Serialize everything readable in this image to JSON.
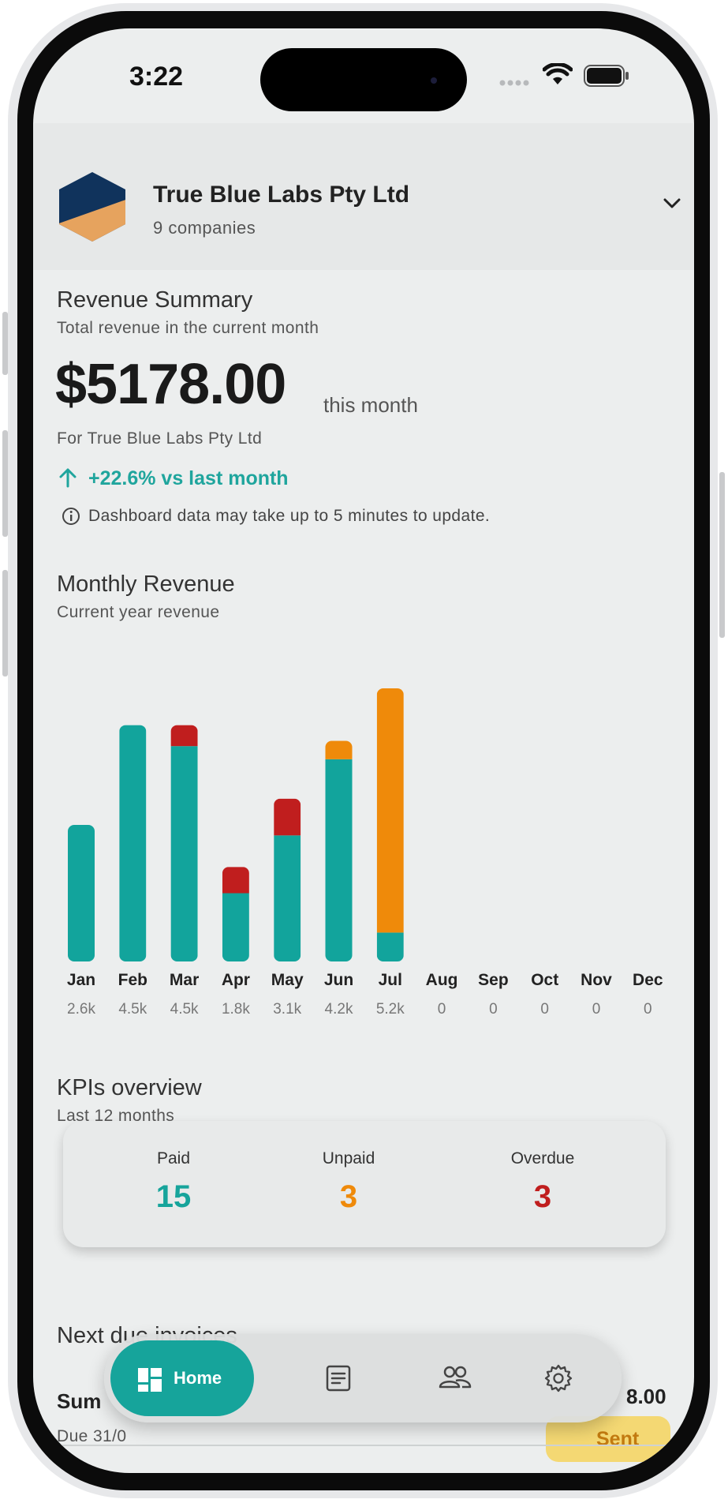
{
  "status_bar": {
    "time": "3:22"
  },
  "header": {
    "company_name": "True Blue Labs Pty Ltd",
    "company_count": "9 companies"
  },
  "revenue_summary": {
    "title": "Revenue Summary",
    "subtitle": "Total revenue in the current month",
    "amount": "$5178.00",
    "period": "this month",
    "for_company": "For True Blue Labs Pty Ltd",
    "trend": "+22.6% vs last month",
    "notice": "Dashboard data may take up to 5 minutes to update."
  },
  "monthly_revenue": {
    "title": "Monthly Revenue",
    "subtitle": "Current year revenue"
  },
  "chart_data": {
    "type": "bar",
    "categories": [
      "Jan",
      "Feb",
      "Mar",
      "Apr",
      "May",
      "Jun",
      "Jul",
      "Aug",
      "Sep",
      "Oct",
      "Nov",
      "Dec"
    ],
    "value_labels": [
      "2.6k",
      "4.5k",
      "4.5k",
      "1.8k",
      "3.1k",
      "4.2k",
      "5.2k",
      "0",
      "0",
      "0",
      "0",
      "0"
    ],
    "series": [
      {
        "values": [
          2.6,
          4.5,
          4.1,
          1.3,
          2.4,
          3.85,
          0.55,
          0,
          0,
          0,
          0,
          0
        ]
      },
      {
        "values": [
          0,
          0,
          0.4,
          0.5,
          0.7,
          0,
          0,
          0,
          0,
          0,
          0,
          0
        ]
      },
      {
        "values": [
          0,
          0,
          0,
          0,
          0,
          0.35,
          4.65,
          0,
          0,
          0,
          0,
          0
        ]
      }
    ],
    "colors": [
      "#12a49c",
      "#c01e1e",
      "#ef8a0a"
    ],
    "ylim": [
      0,
      5.2
    ],
    "grid": false
  },
  "kpis": {
    "title": "KPIs overview",
    "subtitle": "Last 12 months",
    "items": [
      {
        "label": "Paid",
        "value": "15",
        "color": "#16a49b"
      },
      {
        "label": "Unpaid",
        "value": "3",
        "color": "#ef8a0a"
      },
      {
        "label": "Overdue",
        "value": "3",
        "color": "#c01e1e"
      }
    ]
  },
  "invoices": {
    "title": "Next due invoices",
    "first": {
      "name": "Sum",
      "due": "Due 31/0",
      "amount": "8.00",
      "status": "Sent"
    }
  },
  "nav": {
    "home_label": "Home"
  },
  "icons": [
    "company-logo-icon",
    "chevron-down-icon",
    "arrow-up-icon",
    "info-icon",
    "dashboard-icon",
    "invoice-icon",
    "customers-icon",
    "settings-icon",
    "wifi-icon",
    "battery-icon"
  ]
}
